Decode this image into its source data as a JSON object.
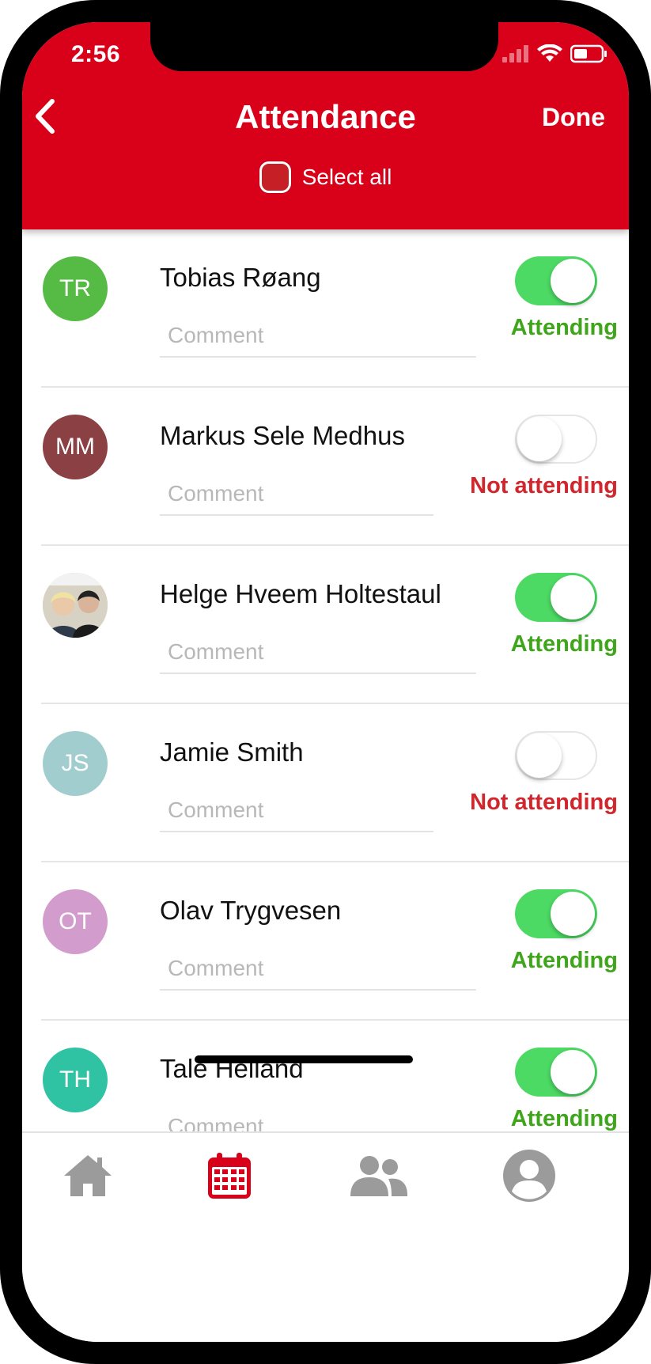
{
  "status_bar": {
    "time": "2:56"
  },
  "header": {
    "title": "Attendance",
    "done_label": "Done",
    "select_all_label": "Select all"
  },
  "colors": {
    "brand": "#d9001a",
    "attending": "#3fa51a",
    "not_attending": "#d0262c",
    "toggle_on": "#4cd964"
  },
  "comment_placeholder": "Comment",
  "attendees": [
    {
      "initials": "TR",
      "name": "Tobias Røang",
      "attending": true,
      "status": "Attending",
      "avatar_color": "#55bb45"
    },
    {
      "initials": "MM",
      "name": "Markus Sele Medhus",
      "attending": false,
      "status": "Not attending",
      "avatar_color": "#8b4044"
    },
    {
      "initials": "",
      "name": "Helge Hveem Holtestaul",
      "attending": true,
      "status": "Attending",
      "avatar_color": "#cfc9bd",
      "photo": true
    },
    {
      "initials": "JS",
      "name": "Jamie Smith",
      "attending": false,
      "status": "Not attending",
      "avatar_color": "#a1cdce"
    },
    {
      "initials": "OT",
      "name": "Olav Trygvesen",
      "attending": true,
      "status": "Attending",
      "avatar_color": "#d29ccc"
    },
    {
      "initials": "TH",
      "name": "Tale Helland",
      "attending": true,
      "status": "Attending",
      "avatar_color": "#2fc2a3"
    },
    {
      "initials": "",
      "name": "",
      "attending": true,
      "status": "",
      "avatar_color": "#3e5f85"
    }
  ],
  "tabs": [
    {
      "name": "home",
      "icon": "home-icon",
      "active": false
    },
    {
      "name": "calendar",
      "icon": "calendar-icon",
      "active": true
    },
    {
      "name": "team",
      "icon": "people-icon",
      "active": false
    },
    {
      "name": "profile",
      "icon": "profile-icon",
      "active": false
    }
  ]
}
